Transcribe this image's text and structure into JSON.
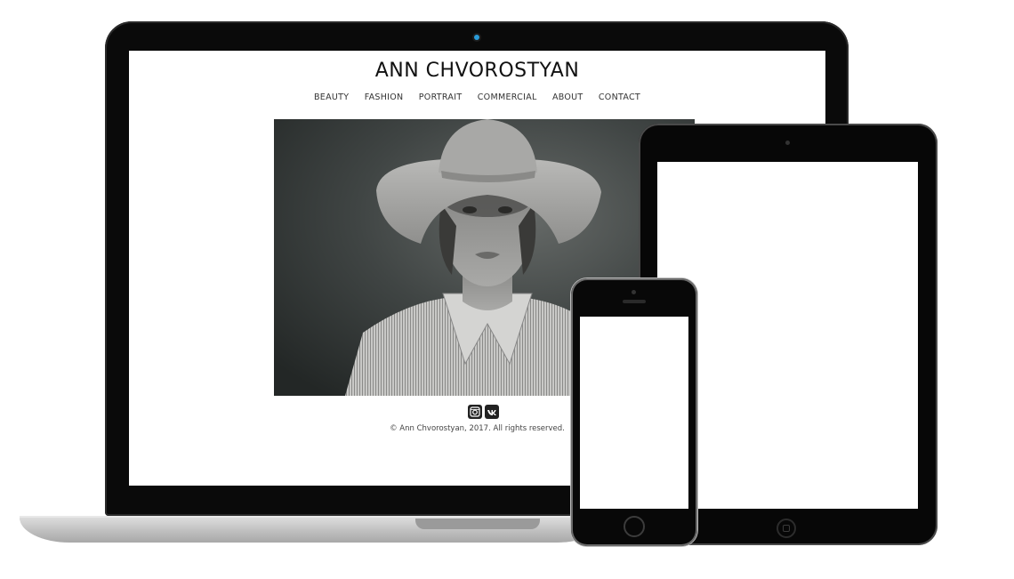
{
  "site": {
    "title": "ANN CHVOROSTYAN",
    "nav": [
      {
        "label": "BEAUTY"
      },
      {
        "label": "FASHION"
      },
      {
        "label": "PORTRAIT"
      },
      {
        "label": "COMMERCIAL"
      },
      {
        "label": "ABOUT"
      },
      {
        "label": "CONTACT"
      }
    ],
    "hero_image": "black-and-white portrait photo",
    "social": [
      {
        "icon": "instagram-icon"
      },
      {
        "icon": "vk-icon"
      }
    ],
    "copyright": "© Ann Chvorostyan, 2017. All rights reserved."
  },
  "devices": [
    "laptop",
    "tablet",
    "phone"
  ],
  "colors": {
    "device_body": "#0a0a0a",
    "screen": "#ffffff",
    "laptop_base": "#c8c8c8"
  }
}
